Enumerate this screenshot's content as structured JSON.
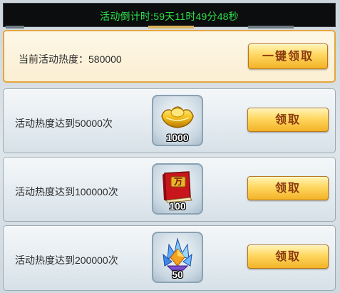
{
  "countdown": "活动倒计时:59天11时49分48秒",
  "heat": {
    "label": "当前活动热度：580000",
    "claim_all_label": "一键领取"
  },
  "rewards": [
    {
      "label": "活动热度达到50000次",
      "icon": "gold-ingot-icon",
      "quantity": "1000",
      "button_label": "领取"
    },
    {
      "label": "活动热度达到100000次",
      "icon": "red-book-icon",
      "book_char": "万",
      "quantity": "100",
      "button_label": "领取"
    },
    {
      "label": "活动热度达到200000次",
      "icon": "crystal-gem-icon",
      "quantity": "50",
      "button_label": "领取"
    }
  ],
  "colors": {
    "countdown_text": "#2fe04a",
    "button_text": "#8a3a0e",
    "heat_border": "#e6a53c"
  }
}
